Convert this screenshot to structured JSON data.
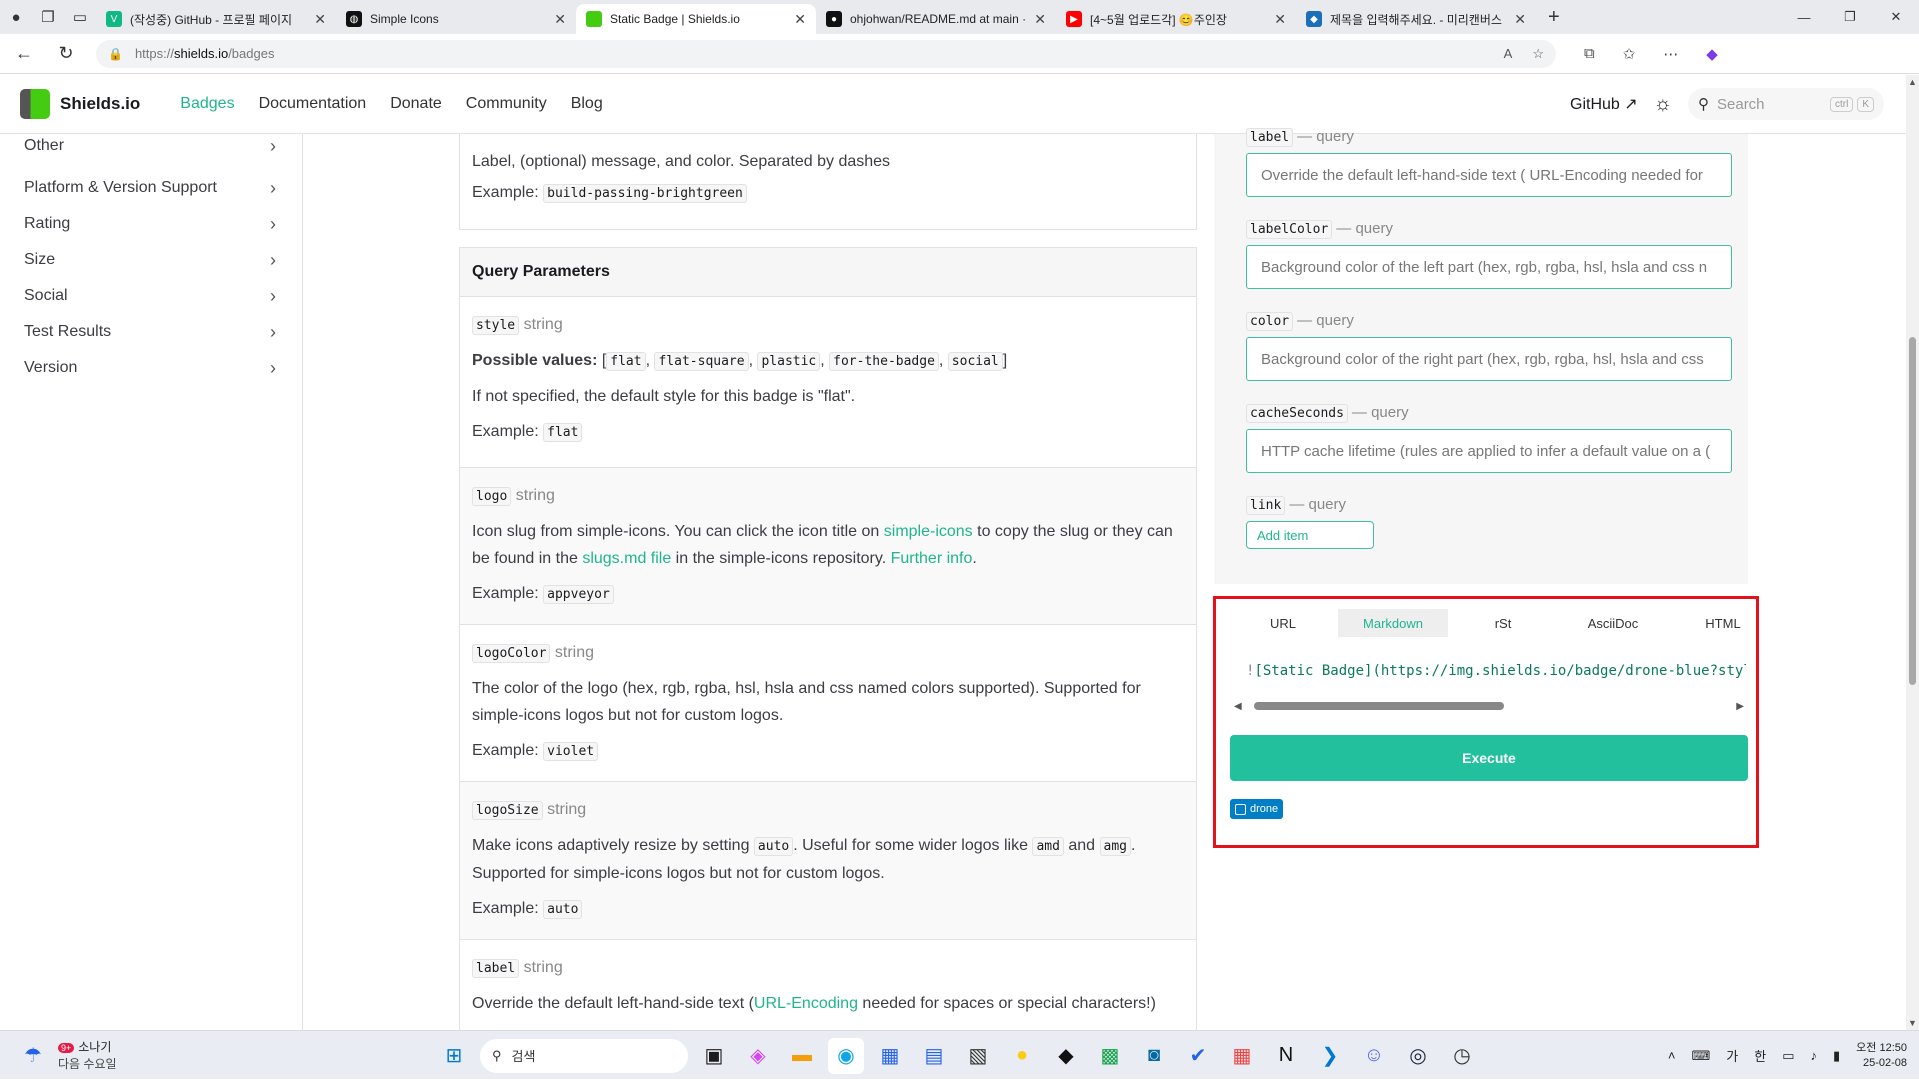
{
  "browser": {
    "tabs": [
      {
        "title": "(작성중) GitHub - 프로필 페이지",
        "favicon_color": "#10b981",
        "favicon_glyph": "V",
        "active": false
      },
      {
        "title": "Simple Icons",
        "favicon_color": "#111111",
        "favicon_glyph": "◍",
        "active": false
      },
      {
        "title": "Static Badge | Shields.io",
        "favicon_color": "#4c1",
        "favicon_glyph": "",
        "active": true
      },
      {
        "title": "ohjohwan/README.md at main ·",
        "favicon_color": "#111111",
        "favicon_glyph": "●",
        "active": false
      },
      {
        "title": "[4~5월 업로드각] 😊주인장",
        "favicon_color": "#ff0000",
        "favicon_glyph": "▶",
        "active": false
      },
      {
        "title": "제목을 입력해주세요. - 미리캔버스",
        "favicon_color": "#1b6fb8",
        "favicon_glyph": "◆",
        "active": false
      }
    ],
    "url_prefix": "https://",
    "url_host": "shields.io",
    "url_path": "/badges"
  },
  "site": {
    "brand": "Shields.io",
    "nav": [
      "Badges",
      "Documentation",
      "Donate",
      "Community",
      "Blog"
    ],
    "github_label": "GitHub",
    "search_placeholder": "Search",
    "search_kbd": [
      "ctrl",
      "K"
    ]
  },
  "sidebar": {
    "items": [
      "Other",
      "Platform & Version Support",
      "Rating",
      "Size",
      "Social",
      "Test Results",
      "Version"
    ]
  },
  "main": {
    "path_desc": "Label, (optional) message, and color. Separated by dashes",
    "path_example_label": "Example:",
    "path_example": "build-passing-brightgreen",
    "query_title": "Query Parameters",
    "params": [
      {
        "name": "style",
        "type": "string",
        "possible_label": "Possible values:",
        "possible": [
          "flat",
          "flat-square",
          "plastic",
          "for-the-badge",
          "social"
        ],
        "desc": "If not specified, the default style for this badge is \"flat\".",
        "example": "flat"
      },
      {
        "name": "logo",
        "type": "string",
        "desc_a": "Icon slug from simple-icons. You can click the icon title on ",
        "link1": "simple-icons",
        "desc_b": " to copy the slug or they can be found in the ",
        "link2": "slugs.md file",
        "desc_c": " in the simple-icons repository. ",
        "link3": "Further info",
        "desc_d": ".",
        "example": "appveyor"
      },
      {
        "name": "logoColor",
        "type": "string",
        "desc": "The color of the logo (hex, rgb, rgba, hsl, hsla and css named colors supported). Supported for simple-icons logos but not for custom logos.",
        "example": "violet"
      },
      {
        "name": "logoSize",
        "type": "string",
        "desc_a": "Make icons adaptively resize by setting ",
        "code1": "auto",
        "desc_b": ". Useful for some wider logos like ",
        "code2": "amd",
        "desc_c": " and ",
        "code3": "amg",
        "desc_d": ". Supported for simple-icons logos but not for custom logos.",
        "example": "auto"
      },
      {
        "name": "label",
        "type": "string",
        "desc_a": "Override the default left-hand-side text (",
        "link1": "URL-Encoding",
        "desc_b": " needed for spaces or special characters!)"
      }
    ]
  },
  "builder": {
    "separator": "— query",
    "fields": [
      {
        "name": "label",
        "placeholder": "Override the default left-hand-side text ( URL-Encoding needed for"
      },
      {
        "name": "labelColor",
        "placeholder": "Background color of the left part (hex, rgb, rgba, hsl, hsla and css n"
      },
      {
        "name": "color",
        "placeholder": "Background color of the right part (hex, rgb, rgba, hsl, hsla and css"
      },
      {
        "name": "cacheSeconds",
        "placeholder": "HTTP cache lifetime (rules are applied to infer a default value on a ("
      }
    ],
    "link_field": "link",
    "add_item": "Add item",
    "formats": [
      "URL",
      "Markdown",
      "rSt",
      "AsciiDoc",
      "HTML"
    ],
    "active_format": "Markdown",
    "snippet_bang": "!",
    "snippet": "[Static Badge](https://img.shields.io/badge/drone-blue?style",
    "execute": "Execute",
    "badge_text": "drone",
    "badge_color": "#007ec6"
  },
  "taskbar": {
    "weather_badge": "9+",
    "weather_title": "소나기",
    "weather_sub": "다음 수요일",
    "search_text": "검색",
    "ime": [
      "가",
      "한"
    ],
    "time": "오전 12:50",
    "date": "25-02-08"
  },
  "colors": {
    "accent": "#20b58e",
    "highlight_border": "#e3121c"
  }
}
